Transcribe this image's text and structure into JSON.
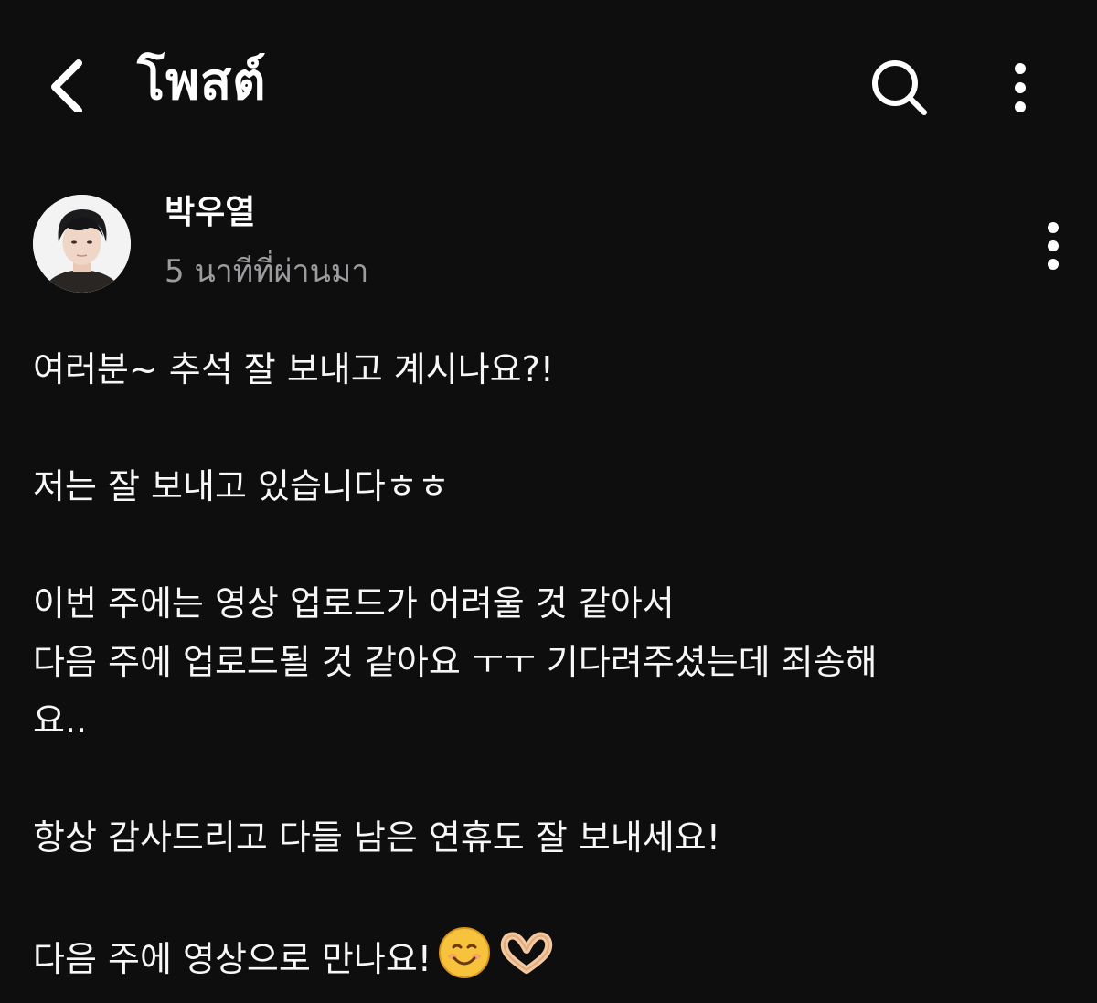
{
  "header": {
    "title": "โพสต์",
    "back_icon": "chevron-left-icon",
    "search_icon": "search-icon",
    "more_icon": "more-vertical-icon"
  },
  "post": {
    "author": "박우열",
    "time": "5 นาทีที่ผ่านมา",
    "paragraphs": [
      [
        "여러분~ 추석 잘 보내고 계시나요?!"
      ],
      [
        "저는 잘 보내고 있습니다ㅎㅎ"
      ],
      [
        "이번 주에는 영상 업로드가 어려울 것 같아서",
        "다음 주에 업로드될 것 같아요 ㅜㅜ 기다려주셨는데 죄송해",
        "요.."
      ],
      [
        "항상 감사드리고 다들 남은 연휴도 잘 보내세요!"
      ],
      [
        "다음 주에 영상으로 만나요!"
      ]
    ],
    "emojis": [
      "smiling-face-icon",
      "heart-hands-icon"
    ]
  },
  "colors": {
    "background": "#0e0e0f",
    "text": "#f7f7f7",
    "secondary_text": "#9c9c9f"
  }
}
